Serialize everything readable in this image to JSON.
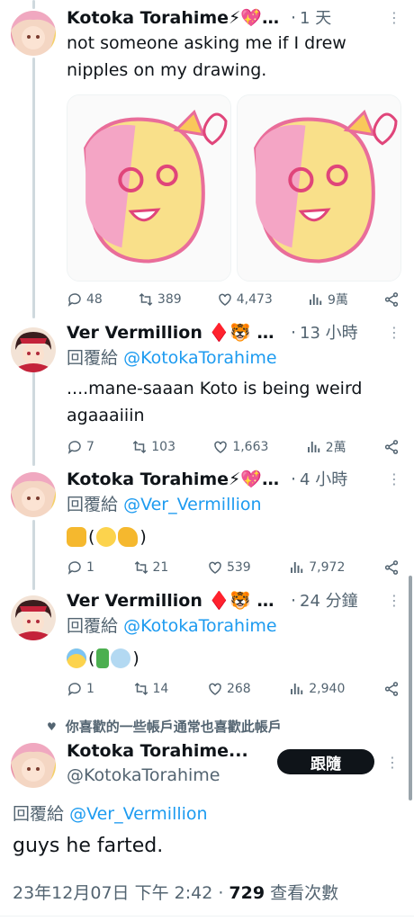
{
  "tweets": [
    {
      "name": "Kotoka Torahime⚡💖NIJI...",
      "time": "1 天",
      "text": "not someone asking me if I drew nipples on my drawing.",
      "stats": {
        "replies": "48",
        "retweets": "389",
        "likes": "4,473",
        "views": "9萬"
      }
    },
    {
      "name": "Ver Vermillion ♦️🐯 NI...",
      "time": "13 小時",
      "reply_prefix": "回覆給",
      "reply_handle": "@KotokaTorahime",
      "text": "....mane-saaan Koto is being weird agaaaiiin",
      "stats": {
        "replies": "7",
        "retweets": "103",
        "likes": "1,663",
        "views": "2萬"
      }
    },
    {
      "name": "Kotoka Torahime⚡💖N...",
      "time": "4 小時",
      "reply_prefix": "回覆給",
      "reply_handle": "@Ver_Vermillion",
      "emoji_text": {
        "open": "(",
        "close": ")"
      },
      "emoji_icons": [
        "fist-emoji",
        "grin-emoji",
        "flex-emoji"
      ],
      "stats": {
        "replies": "1",
        "retweets": "21",
        "likes": "539",
        "views": "7,972"
      }
    },
    {
      "name": "Ver Vermillion ♦️🐯 NI...",
      "time": "24 分鐘",
      "reply_prefix": "回覆給",
      "reply_handle": "@KotokaTorahime",
      "emoji_text": {
        "open": "(",
        "close": ")"
      },
      "emoji_icons": [
        "scream-emoji",
        "runner-emoji",
        "dash-emoji"
      ],
      "stats": {
        "replies": "1",
        "retweets": "14",
        "likes": "268",
        "views": "2,940"
      }
    }
  ],
  "suggestion": "你喜歡的一些帳戶通常也喜歡此帳戶",
  "main": {
    "name": "Kotoka Torahime...",
    "handle": "@KotokaTorahime",
    "follow_label": "跟隨",
    "reply_prefix": "回覆給",
    "reply_handle": "@Ver_Vermillion",
    "text": "guys he farted.",
    "date": "23年12月07日 下午 2:42 · ",
    "views": "729",
    "views_label": " 查看次數"
  },
  "colors": {
    "link": "#1d9bf0",
    "muted": "#536471",
    "text": "#0f1419"
  }
}
